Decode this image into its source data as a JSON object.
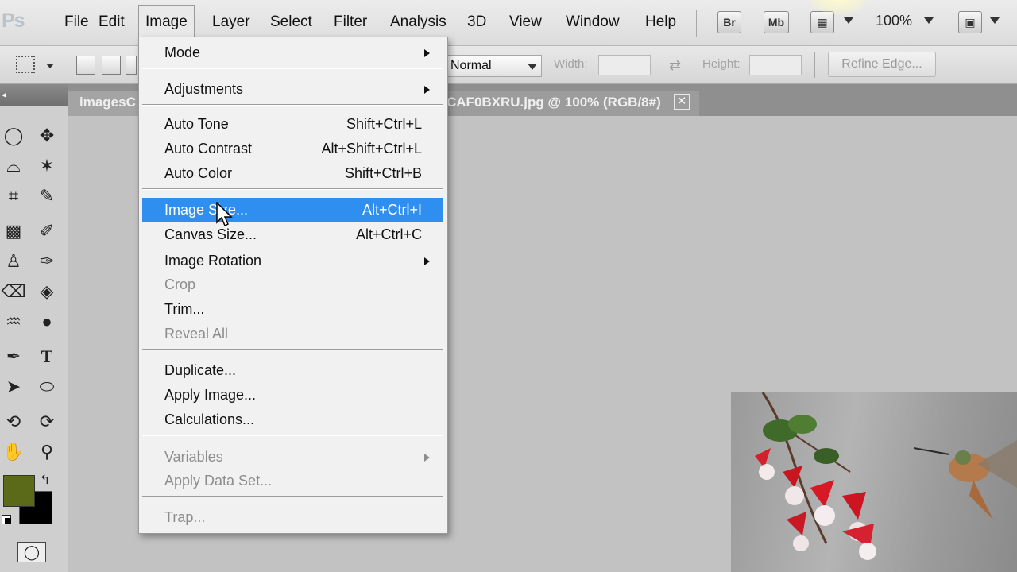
{
  "app": {
    "logo": "Ps",
    "menu": [
      "File",
      "Edit",
      "Image",
      "Layer",
      "Select",
      "Filter",
      "Analysis",
      "3D",
      "View",
      "Window",
      "Help"
    ],
    "active_menu": "Image",
    "bridge_button": "Br",
    "minibridge_button": "Mb",
    "zoom": "100%"
  },
  "options_bar": {
    "style_value": "Normal",
    "width_label": "Width:",
    "width_value": "",
    "height_label": "Height:",
    "height_value": "",
    "refine_edge_label": "Refine Edge..."
  },
  "tabs": {
    "first": "imagesC",
    "second": "CAF0BXRU.jpg @ 100% (RGB/8#)",
    "close_symbol": "✕"
  },
  "toolbox": {
    "foreground_color": "#5a6a18",
    "background_color": "#000000"
  },
  "image_menu": {
    "items": [
      {
        "label": "Mode",
        "shortcut": "",
        "submenu": true,
        "disabled": false
      },
      {
        "label": "Adjustments",
        "shortcut": "",
        "submenu": true,
        "disabled": false
      },
      {
        "label": "Auto Tone",
        "shortcut": "Shift+Ctrl+L",
        "submenu": false,
        "disabled": false
      },
      {
        "label": "Auto Contrast",
        "shortcut": "Alt+Shift+Ctrl+L",
        "submenu": false,
        "disabled": false
      },
      {
        "label": "Auto Color",
        "shortcut": "Shift+Ctrl+B",
        "submenu": false,
        "disabled": false
      },
      {
        "label": "Image Size...",
        "shortcut": "Alt+Ctrl+I",
        "submenu": false,
        "disabled": false,
        "highlighted": true
      },
      {
        "label": "Canvas Size...",
        "shortcut": "Alt+Ctrl+C",
        "submenu": false,
        "disabled": false
      },
      {
        "label": "Image Rotation",
        "shortcut": "",
        "submenu": true,
        "disabled": false
      },
      {
        "label": "Crop",
        "shortcut": "",
        "submenu": false,
        "disabled": true
      },
      {
        "label": "Trim...",
        "shortcut": "",
        "submenu": false,
        "disabled": false
      },
      {
        "label": "Reveal All",
        "shortcut": "",
        "submenu": false,
        "disabled": true
      },
      {
        "label": "Duplicate...",
        "shortcut": "",
        "submenu": false,
        "disabled": false
      },
      {
        "label": "Apply Image...",
        "shortcut": "",
        "submenu": false,
        "disabled": false
      },
      {
        "label": "Calculations...",
        "shortcut": "",
        "submenu": false,
        "disabled": false
      },
      {
        "label": "Variables",
        "shortcut": "",
        "submenu": true,
        "disabled": true
      },
      {
        "label": "Apply Data Set...",
        "shortcut": "",
        "submenu": false,
        "disabled": true
      },
      {
        "label": "Trap...",
        "shortcut": "",
        "submenu": false,
        "disabled": true
      }
    ],
    "highlight_color": "#2f8ff0"
  }
}
